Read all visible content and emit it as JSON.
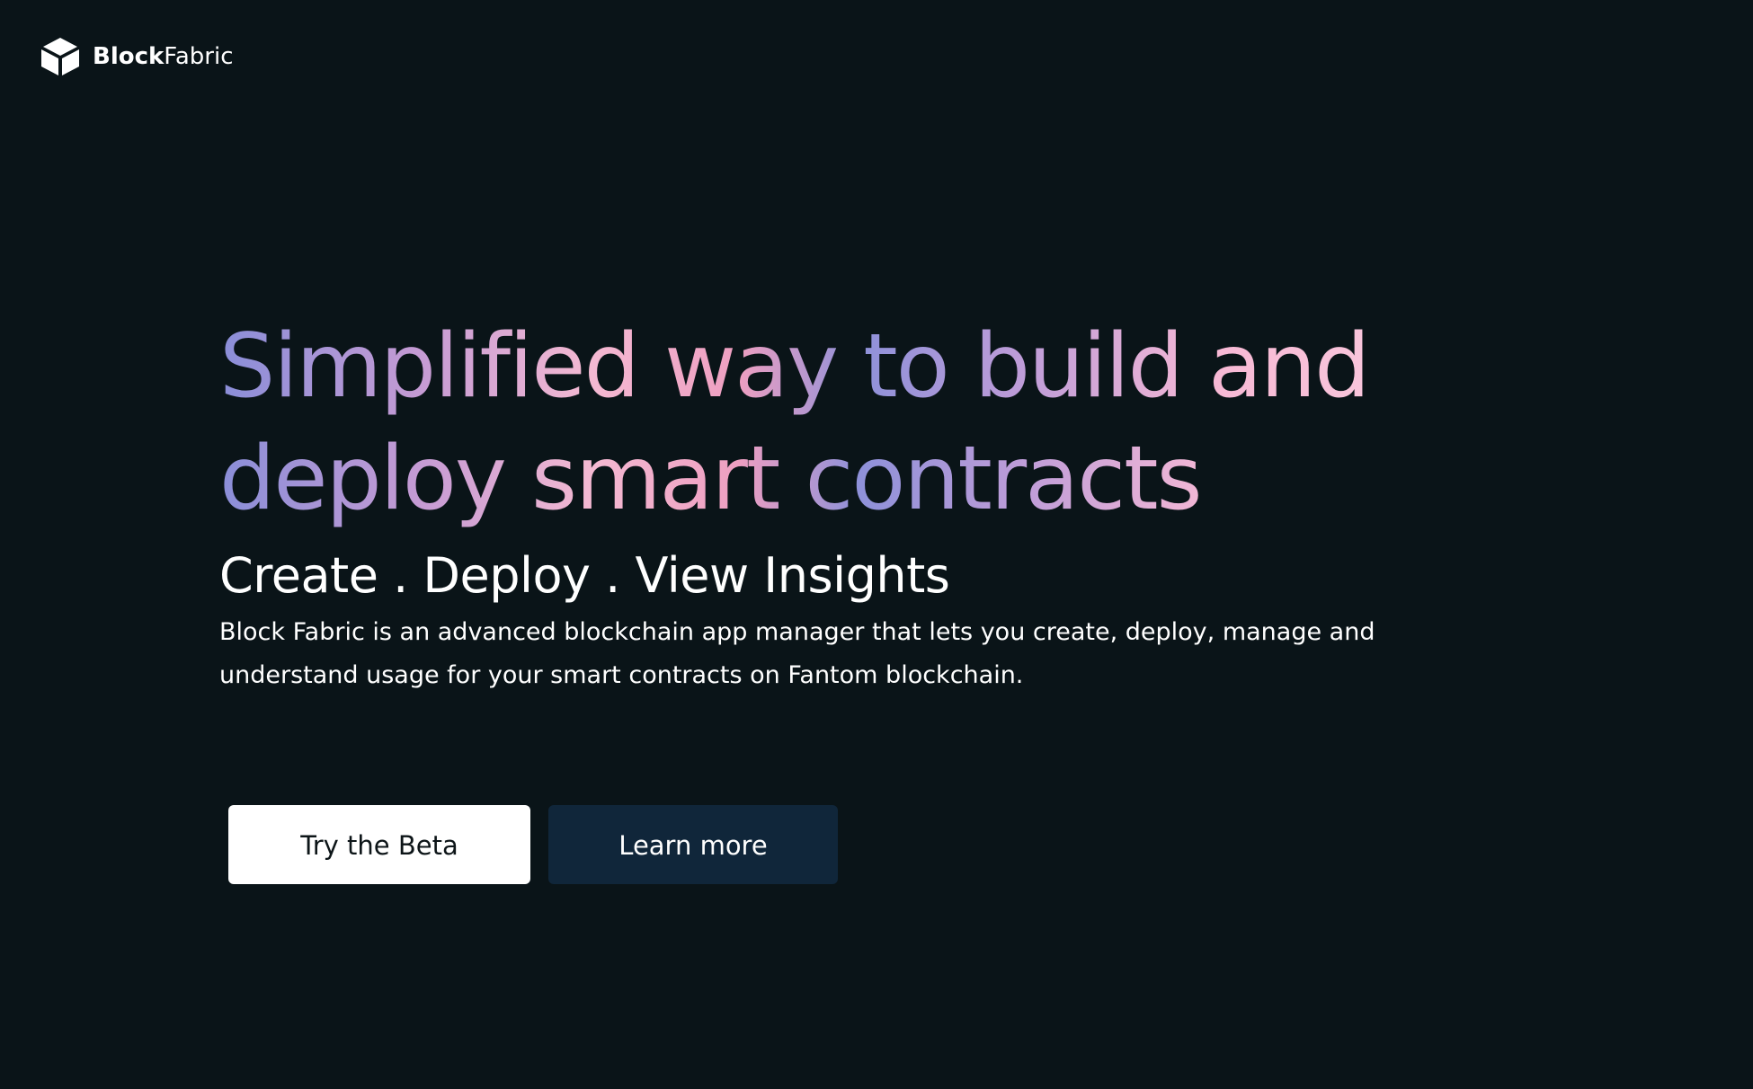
{
  "header": {
    "logo": {
      "icon": "cube-icon",
      "bold_text": "Block",
      "light_text": "Fabric"
    }
  },
  "hero": {
    "headline_line_1": "Simplified way to build and",
    "headline_line_2": "deploy smart contracts",
    "tagline": "Create . Deploy . View Insights",
    "description": "Block Fabric is an advanced blockchain app manager that lets you create, deploy, manage and understand usage for your smart contracts on Fantom blockchain.",
    "primary_button": "Try the Beta",
    "secondary_button": "Learn more"
  },
  "colors": {
    "background": "#0a1418",
    "primary_button_background": "#ffffff",
    "secondary_button_background": "#10263a",
    "headline_gradient": [
      "#8a8ed8",
      "#c59bd4",
      "#f4b9d2",
      "#8e91d9",
      "#f7b9d5"
    ]
  }
}
